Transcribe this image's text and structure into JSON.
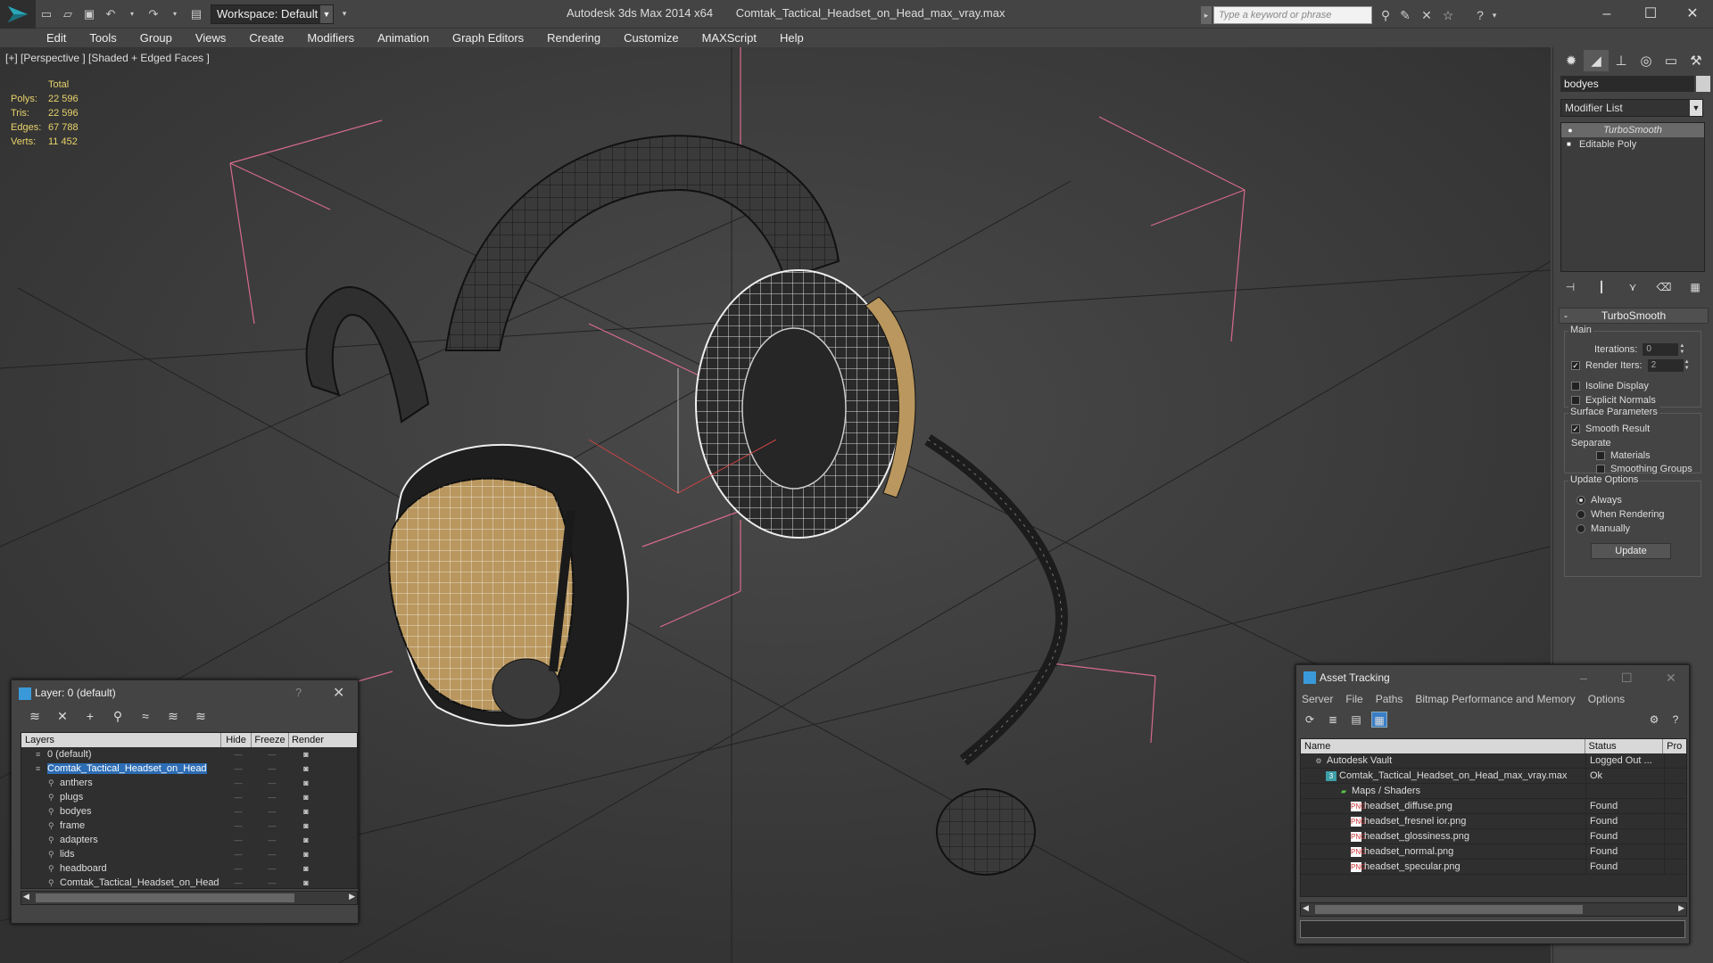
{
  "titlebar": {
    "workspace_label": "Workspace: Default",
    "app_name": "Autodesk 3ds Max  2014 x64",
    "file_name": "Comtak_Tactical_Headset_on_Head_max_vray.max",
    "search_placeholder": "Type a keyword or phrase"
  },
  "menu": [
    "Edit",
    "Tools",
    "Group",
    "Views",
    "Create",
    "Modifiers",
    "Animation",
    "Graph Editors",
    "Rendering",
    "Customize",
    "MAXScript",
    "Help"
  ],
  "viewport": {
    "label": "[+] [Perspective ] [Shaded + Edged Faces ]",
    "stats": {
      "header": "Total",
      "polys_label": "Polys:",
      "polys": "22 596",
      "tris_label": "Tris:",
      "tris": "22 596",
      "edges_label": "Edges:",
      "edges": "67 788",
      "verts_label": "Verts:",
      "verts": "11 452"
    }
  },
  "command_panel": {
    "object_name": "bodyes",
    "modifier_list": "Modifier List",
    "stack": [
      "TurboSmooth",
      "Editable Poly"
    ],
    "rollout_title": "TurboSmooth",
    "main_group": "Main",
    "iterations_label": "Iterations:",
    "iterations_value": "0",
    "render_iters_label": "Render Iters:",
    "render_iters_value": "2",
    "isoline_label": "Isoline Display",
    "explicit_normals_label": "Explicit Normals",
    "surface_group": "Surface Parameters",
    "smooth_result_label": "Smooth Result",
    "separate_label": "Separate",
    "materials_label": "Materials",
    "smoothing_groups_label": "Smoothing Groups",
    "update_group": "Update Options",
    "always_label": "Always",
    "when_rendering_label": "When Rendering",
    "manually_label": "Manually",
    "update_button": "Update"
  },
  "layer_dialog": {
    "title": "Layer: 0 (default)",
    "help": "?",
    "columns": [
      "Layers",
      "Hide",
      "Freeze",
      "Render"
    ],
    "rows": [
      {
        "name": "0 (default)",
        "indent": 1
      },
      {
        "name": "Comtak_Tactical_Headset_on_Head",
        "indent": 1,
        "selected": true
      },
      {
        "name": "anthers",
        "indent": 2
      },
      {
        "name": "plugs",
        "indent": 2
      },
      {
        "name": "bodyes",
        "indent": 2
      },
      {
        "name": "frame",
        "indent": 2
      },
      {
        "name": "adapters",
        "indent": 2
      },
      {
        "name": "lids",
        "indent": 2
      },
      {
        "name": "headboard",
        "indent": 2
      },
      {
        "name": "Comtak_Tactical_Headset_on_Head",
        "indent": 2
      }
    ]
  },
  "asset_dialog": {
    "title": "Asset Tracking",
    "menu": [
      "Server",
      "File",
      "Paths",
      "Bitmap Performance and Memory",
      "Options"
    ],
    "columns": [
      "Name",
      "Status",
      "Pro"
    ],
    "rows": [
      {
        "name": "Autodesk Vault",
        "status": "Logged Out ...",
        "icon": "vault",
        "indent": 1
      },
      {
        "name": "Comtak_Tactical_Headset_on_Head_max_vray.max",
        "status": "Ok",
        "icon": "max",
        "indent": 2
      },
      {
        "name": "Maps / Shaders",
        "status": "",
        "icon": "folder",
        "indent": 3
      },
      {
        "name": "headset_diffuse.png",
        "status": "Found",
        "icon": "png",
        "indent": 4
      },
      {
        "name": "headset_fresnel ior.png",
        "status": "Found",
        "icon": "png",
        "indent": 4
      },
      {
        "name": "headset_glossiness.png",
        "status": "Found",
        "icon": "png",
        "indent": 4
      },
      {
        "name": "headset_normal.png",
        "status": "Found",
        "icon": "png",
        "indent": 4
      },
      {
        "name": "headset_specular.png",
        "status": "Found",
        "icon": "png",
        "indent": 4
      }
    ]
  },
  "colors": {
    "stats": "#e8d36a",
    "selection": "#2d6db5",
    "grid": "#222222",
    "bbox": "#e06a8a",
    "earcup": "#b9975e"
  }
}
